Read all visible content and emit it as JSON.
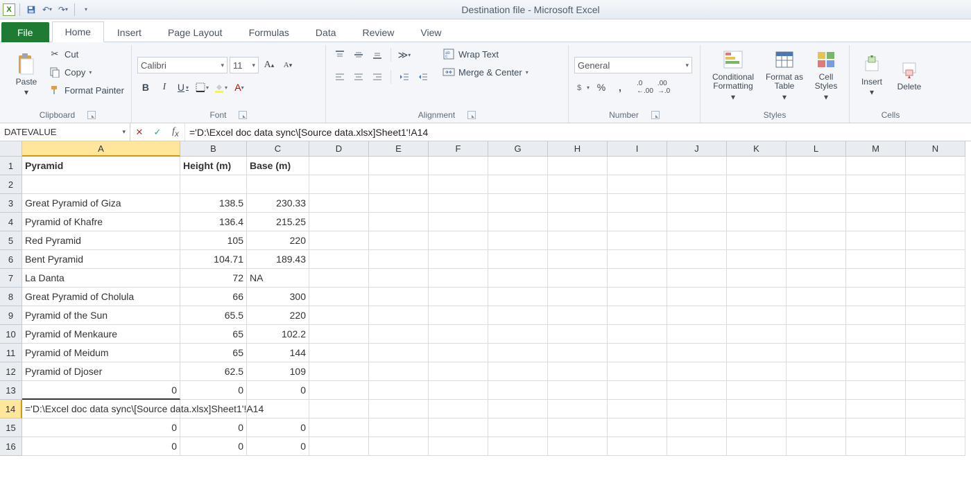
{
  "window": {
    "title": "Destination file  -  Microsoft Excel"
  },
  "qat": {
    "save": "Save",
    "undo": "Undo",
    "redo": "Redo"
  },
  "tabs": {
    "file": "File",
    "items": [
      "Home",
      "Insert",
      "Page Layout",
      "Formulas",
      "Data",
      "Review",
      "View"
    ],
    "active": "Home"
  },
  "ribbon": {
    "clipboard": {
      "label": "Clipboard",
      "paste": "Paste",
      "cut": "Cut",
      "copy": "Copy",
      "format_painter": "Format Painter"
    },
    "font": {
      "label": "Font",
      "name": "Calibri",
      "size": "11"
    },
    "alignment": {
      "label": "Alignment",
      "wrap": "Wrap Text",
      "merge": "Merge & Center"
    },
    "number": {
      "label": "Number",
      "format": "General"
    },
    "styles": {
      "label": "Styles",
      "cond": "Conditional Formatting",
      "table": "Format as Table",
      "cell": "Cell Styles"
    },
    "cells": {
      "label": "Cells",
      "insert": "Insert",
      "delete": "Delete"
    }
  },
  "namebox": "DATEVALUE",
  "formula": "='D:\\Excel doc data sync\\[Source data.xlsx]Sheet1'!A14",
  "columns": [
    "A",
    "B",
    "C",
    "D",
    "E",
    "F",
    "G",
    "H",
    "I",
    "J",
    "K",
    "L",
    "M",
    "N"
  ],
  "col_active": "A",
  "row_active": 14,
  "rows_shown": 16,
  "headers": {
    "A": "Pyramid",
    "B": "Height (m)",
    "C": "Base (m)"
  },
  "data": [
    {
      "r": 3,
      "A": "Great Pyramid of Giza",
      "B": "138.5",
      "C": "230.33"
    },
    {
      "r": 4,
      "A": "Pyramid of Khafre",
      "B": "136.4",
      "C": "215.25"
    },
    {
      "r": 5,
      "A": "Red Pyramid",
      "B": "105",
      "C": "220"
    },
    {
      "r": 6,
      "A": "Bent Pyramid",
      "B": "104.71",
      "C": "189.43"
    },
    {
      "r": 7,
      "A": "La Danta",
      "B": "72",
      "C": "NA",
      "C_align": "left"
    },
    {
      "r": 8,
      "A": "Great Pyramid of Cholula",
      "B": "66",
      "C": "300"
    },
    {
      "r": 9,
      "A": "Pyramid of the Sun",
      "B": "65.5",
      "C": "220"
    },
    {
      "r": 10,
      "A": "Pyramid of Menkaure",
      "B": "65",
      "C": "102.2"
    },
    {
      "r": 11,
      "A": "Pyramid of Meidum",
      "B": "65",
      "C": "144"
    },
    {
      "r": 12,
      "A": "Pyramid of Djoser",
      "B": "62.5",
      "C": "109"
    },
    {
      "r": 13,
      "A": "0",
      "A_align": "right",
      "B": "0",
      "C": "0"
    },
    {
      "r": 14,
      "A": "='D:\\Excel doc data sync\\[Source data.xlsx]Sheet1'!A14",
      "overflow": true
    },
    {
      "r": 15,
      "A": "0",
      "A_align": "right",
      "B": "0",
      "C": "0"
    },
    {
      "r": 16,
      "A": "0",
      "A_align": "right",
      "B": "0",
      "C": "0"
    }
  ],
  "chart_data": {
    "type": "table",
    "title": "Pyramid dimensions",
    "columns": [
      "Pyramid",
      "Height (m)",
      "Base (m)"
    ],
    "rows": [
      [
        "Great Pyramid of Giza",
        138.5,
        230.33
      ],
      [
        "Pyramid of Khafre",
        136.4,
        215.25
      ],
      [
        "Red Pyramid",
        105,
        220
      ],
      [
        "Bent Pyramid",
        104.71,
        189.43
      ],
      [
        "La Danta",
        72,
        null
      ],
      [
        "Great Pyramid of Cholula",
        66,
        300
      ],
      [
        "Pyramid of the Sun",
        65.5,
        220
      ],
      [
        "Pyramid of Menkaure",
        65,
        102.2
      ],
      [
        "Pyramid of Meidum",
        65,
        144
      ],
      [
        "Pyramid of Djoser",
        62.5,
        109
      ]
    ]
  }
}
